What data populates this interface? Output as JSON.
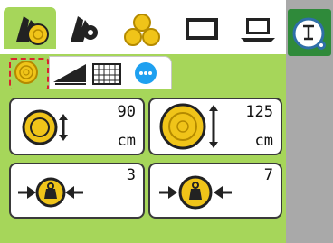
{
  "top_tabs": [
    {
      "name": "bale-crop-icon",
      "active": true
    },
    {
      "name": "baler-settings-icon",
      "active": false
    },
    {
      "name": "bales-stack-icon",
      "active": false
    },
    {
      "name": "display-icon",
      "active": false
    },
    {
      "name": "laptop-icon",
      "active": false
    }
  ],
  "side_button": {
    "icon": "info-settings-icon"
  },
  "sub_tabs": [
    {
      "icon": "bale-icon",
      "active": true
    },
    {
      "icon": "ramp-icon",
      "active": false
    },
    {
      "icon": "net-icon",
      "active": false
    },
    {
      "icon": "more-icon",
      "active": false
    }
  ],
  "cards": {
    "min_diameter": {
      "value": "90",
      "unit": "cm"
    },
    "max_diameter": {
      "value": "125",
      "unit": "cm"
    },
    "pressure_low": {
      "value": "3"
    },
    "pressure_high": {
      "value": "7"
    }
  },
  "colors": {
    "accent": "#a6d65a",
    "dark_green": "#2f8a3a",
    "bale_yellow": "#f0c419",
    "highlight": "#d8262c",
    "gray_panel": "#a9a9a9"
  }
}
